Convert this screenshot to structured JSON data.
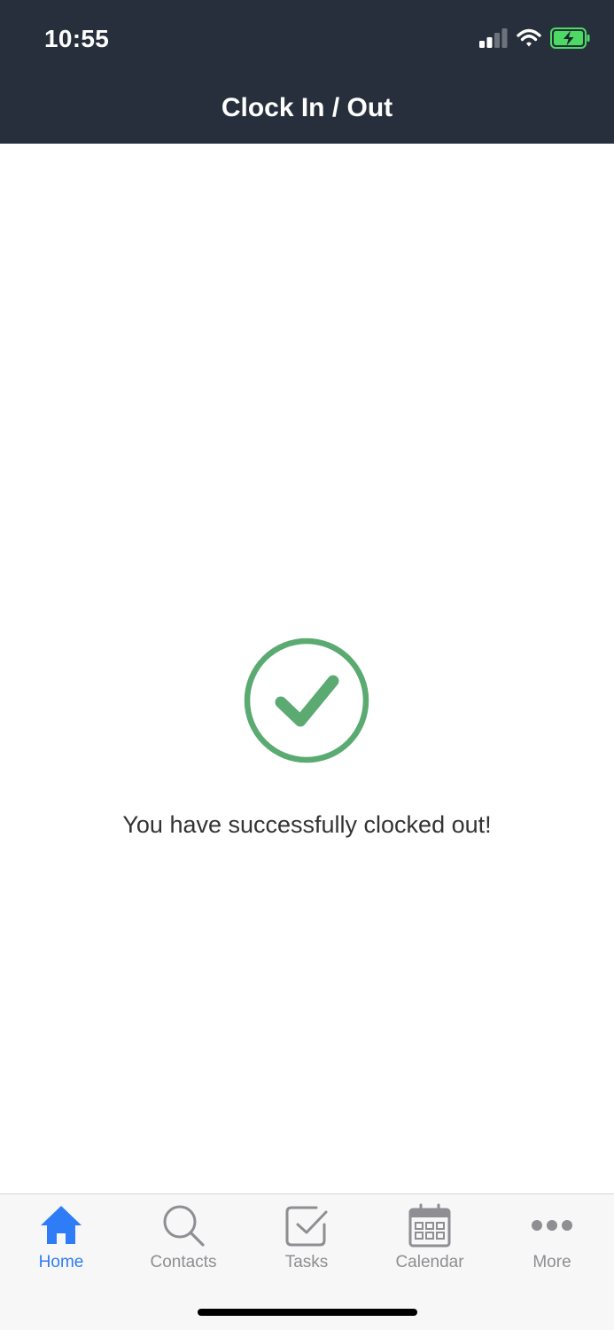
{
  "status_bar": {
    "time": "10:55",
    "icons": [
      "signal-icon",
      "wifi-icon",
      "battery-charging-icon"
    ]
  },
  "nav": {
    "title": "Clock In / Out"
  },
  "main": {
    "icon": "check-circle-icon",
    "message": "You have successfully clocked out!"
  },
  "tab_bar": {
    "tabs": [
      {
        "label": "Home",
        "icon": "home-icon",
        "active": true
      },
      {
        "label": "Contacts",
        "icon": "search-icon",
        "active": false
      },
      {
        "label": "Tasks",
        "icon": "checkbox-icon",
        "active": false
      },
      {
        "label": "Calendar",
        "icon": "calendar-icon",
        "active": false
      },
      {
        "label": "More",
        "icon": "ellipsis-icon",
        "active": false
      }
    ]
  },
  "colors": {
    "header_bg": "#262f3b",
    "success_green": "#5aaa72",
    "tab_active": "#2f7df6",
    "tab_inactive": "#8e8e93",
    "battery_green": "#4cd964"
  }
}
